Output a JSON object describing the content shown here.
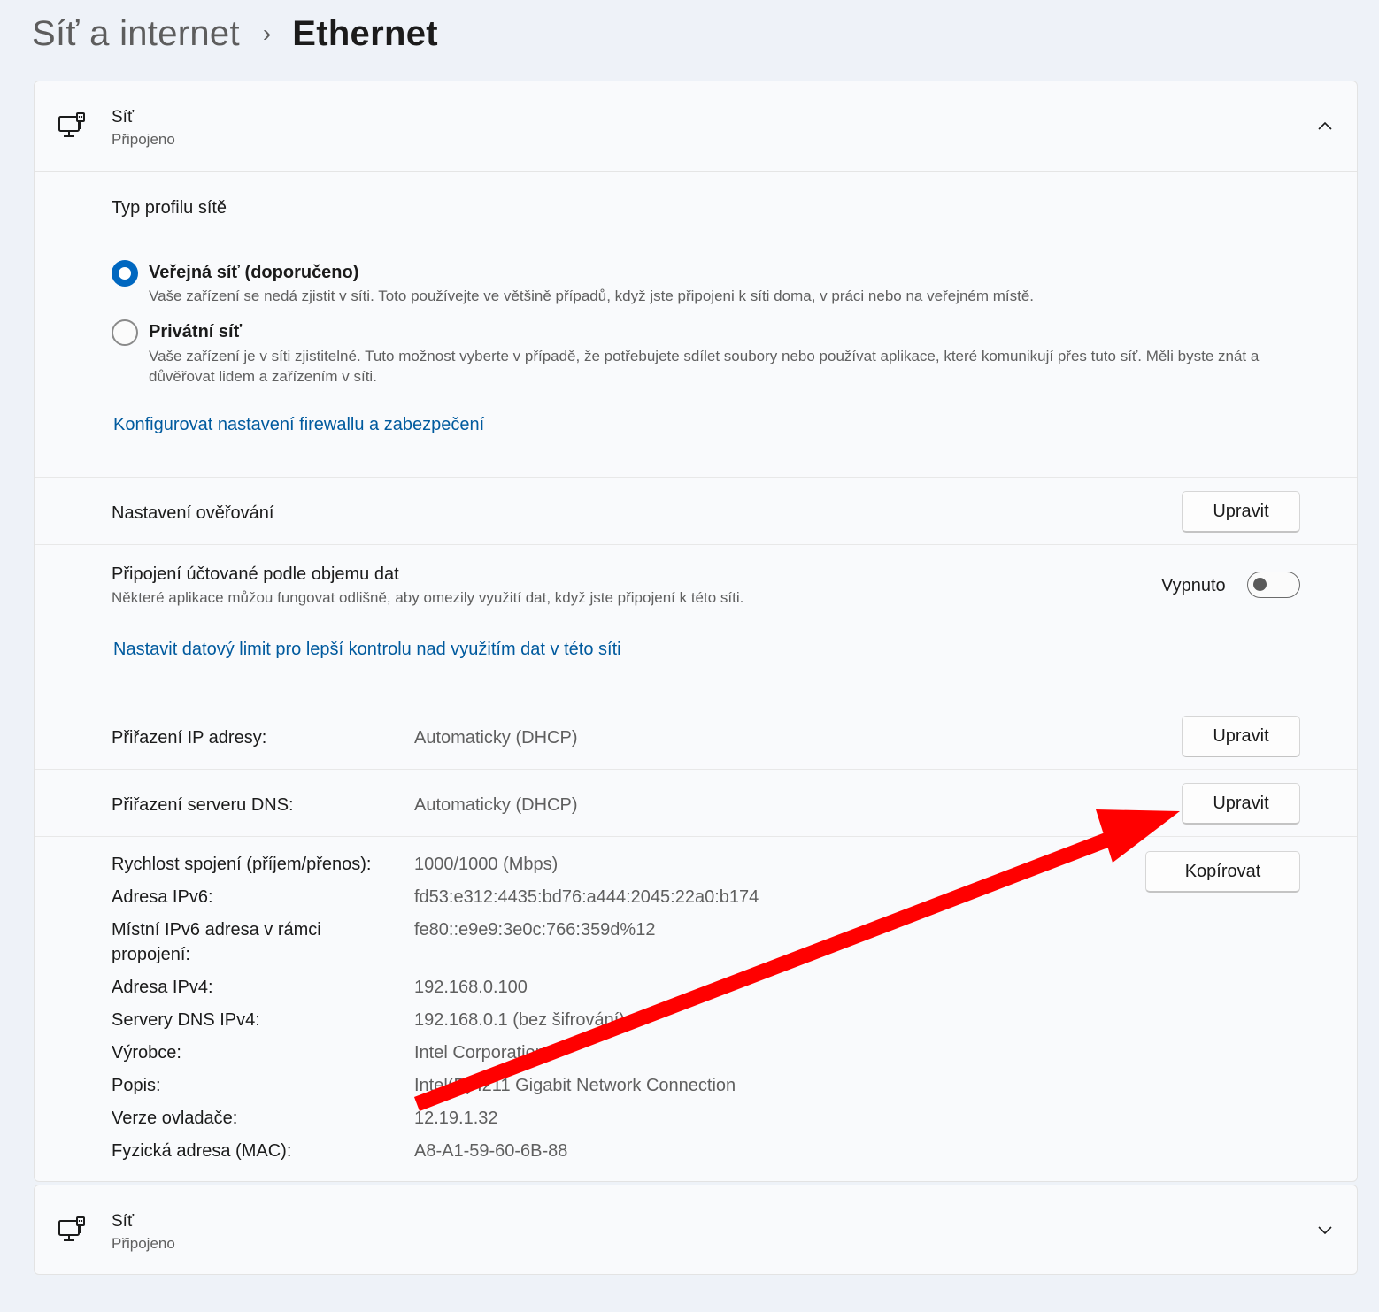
{
  "breadcrumb": {
    "parent": "Síť a internet",
    "separator": "›",
    "current": "Ethernet"
  },
  "network_card": {
    "title": "Síť",
    "status": "Připojeno",
    "profile": {
      "label": "Typ profilu sítě",
      "options": [
        {
          "title": "Veřejná síť (doporučeno)",
          "desc": "Vaše zařízení se nedá zjistit v síti. Toto používejte ve většině případů, když jste připojeni k síti doma, v práci nebo na veřejném místě.",
          "selected": true
        },
        {
          "title": "Privátní síť",
          "desc": "Vaše zařízení je v síti zjistitelné. Tuto možnost vyberte v případě, že potřebujete sdílet soubory nebo používat aplikace, které komunikují přes tuto síť. Měli byste znát a důvěřovat lidem a zařízením v síti.",
          "selected": false
        }
      ],
      "firewall_link": "Konfigurovat nastavení firewallu a zabezpečení"
    },
    "auth": {
      "label": "Nastavení ověřování",
      "button": "Upravit"
    },
    "metered": {
      "title": "Připojení účtované podle objemu dat",
      "desc": "Některé aplikace můžou fungovat odlišně, aby omezily využití dat, když jste připojení k této síti.",
      "toggle_label": "Vypnuto",
      "toggle_on": false,
      "link": "Nastavit datový limit pro lepší kontrolu nad využitím dat v této síti"
    },
    "ip_assignment": {
      "label": "Přiřazení IP adresy:",
      "value": "Automaticky (DHCP)",
      "button": "Upravit"
    },
    "dns_assignment": {
      "label": "Přiřazení serveru DNS:",
      "value": "Automaticky (DHCP)",
      "button": "Upravit"
    },
    "copy_button": "Kopírovat",
    "properties": [
      {
        "label": "Rychlost spojení (příjem/přenos):",
        "value": "1000/1000 (Mbps)"
      },
      {
        "label": "Adresa IPv6:",
        "value": "fd53:e312:4435:bd76:a444:2045:22a0:b174"
      },
      {
        "label": "Místní IPv6 adresa v rámci propojení:",
        "value": "fe80::e9e9:3e0c:766:359d%12"
      },
      {
        "label": "Adresa IPv4:",
        "value": "192.168.0.100"
      },
      {
        "label": "Servery DNS IPv4:",
        "value": "192.168.0.1 (bez šifrování)"
      },
      {
        "label": "Výrobce:",
        "value": "Intel Corporation"
      },
      {
        "label": "Popis:",
        "value": "Intel(R) I211 Gigabit Network Connection"
      },
      {
        "label": "Verze ovladače:",
        "value": "12.19.1.32"
      },
      {
        "label": "Fyzická adresa (MAC):",
        "value": "A8-A1-59-60-6B-88"
      }
    ]
  },
  "second_card": {
    "title": "Síť",
    "status": "Připojeno"
  },
  "colors": {
    "accent": "#0067c0",
    "link": "#005a9e",
    "arrow": "#ff0000",
    "background": "#eef2f8"
  },
  "icons": {
    "network": "ethernet-monitor-icon",
    "expanded": "chevron-up-icon",
    "collapsed": "chevron-down-icon"
  }
}
